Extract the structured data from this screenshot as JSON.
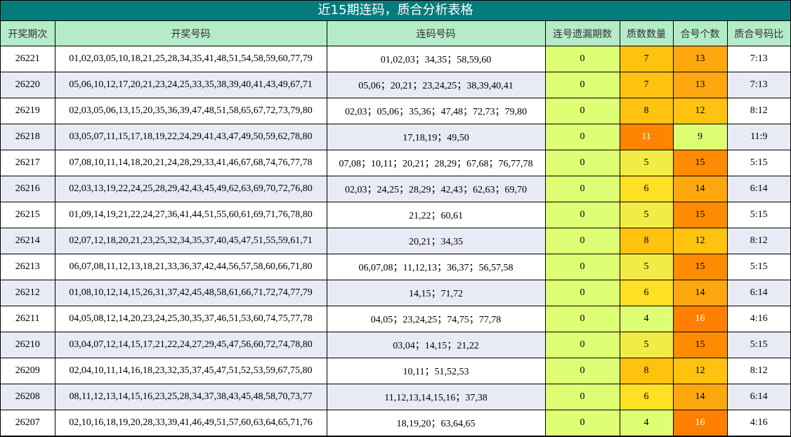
{
  "title": "近15期连码，质合分析表格",
  "headers": [
    "开奖期次",
    "开奖号码",
    "连码号码",
    "连号遗漏期数",
    "质数数量",
    "合号个数",
    "质合号码比"
  ],
  "colors": {
    "title_bg": "#047c7c",
    "header_bg": "#b4ecc9",
    "row_even_bg": "#e8eaf6",
    "miss_bg": "#deff73",
    "level_4": "#deff73",
    "level_5": "#f4ec46",
    "level_6": "#ffe022",
    "level_7": "#ffc30f",
    "level_8": "#ffc30f",
    "level_9": "#deff73",
    "level_11": "#ff8500",
    "level_12": "#ffc30f",
    "level_13": "#ffa70f",
    "level_14": "#ffa70f",
    "level_15": "#ff8c00",
    "level_16": "#ff8000"
  },
  "rows": [
    {
      "issue": "26221",
      "numbers": "01,02,03,05,10,18,21,25,28,34,35,41,48,51,54,58,59,60,77,79",
      "consecutive": "01,02,03；34,35；58,59,60",
      "miss": "0",
      "prime": "7",
      "composite": "13",
      "ratio": "7:13"
    },
    {
      "issue": "26220",
      "numbers": "05,06,10,12,17,20,21,23,24,25,33,35,38,39,40,41,43,49,67,71",
      "consecutive": "05,06；20,21；23,24,25；38,39,40,41",
      "miss": "0",
      "prime": "7",
      "composite": "13",
      "ratio": "7:13"
    },
    {
      "issue": "26219",
      "numbers": "02,03,05,06,13,15,20,35,36,39,47,48,51,58,65,67,72,73,79,80",
      "consecutive": "02,03；05,06；35,36；47,48；72,73；79,80",
      "miss": "0",
      "prime": "8",
      "composite": "12",
      "ratio": "8:12"
    },
    {
      "issue": "26218",
      "numbers": "03,05,07,11,15,17,18,19,22,24,29,41,43,47,49,50,59,62,78,80",
      "consecutive": "17,18,19；49,50",
      "miss": "0",
      "prime": "11",
      "composite": "9",
      "ratio": "11:9"
    },
    {
      "issue": "26217",
      "numbers": "07,08,10,11,14,18,20,21,24,28,29,33,41,46,67,68,74,76,77,78",
      "consecutive": "07,08；10,11；20,21；28,29；67,68；76,77,78",
      "miss": "0",
      "prime": "5",
      "composite": "15",
      "ratio": "5:15"
    },
    {
      "issue": "26216",
      "numbers": "02,03,13,19,22,24,25,28,29,42,43,45,49,62,63,69,70,72,76,80",
      "consecutive": "02,03；24,25；28,29；42,43；62,63；69,70",
      "miss": "0",
      "prime": "6",
      "composite": "14",
      "ratio": "6:14"
    },
    {
      "issue": "26215",
      "numbers": "01,09,14,19,21,22,24,27,36,41,44,51,55,60,61,69,71,76,78,80",
      "consecutive": "21,22；60,61",
      "miss": "0",
      "prime": "5",
      "composite": "15",
      "ratio": "5:15"
    },
    {
      "issue": "26214",
      "numbers": "02,07,12,18,20,21,23,25,32,34,35,37,40,45,47,51,55,59,61,71",
      "consecutive": "20,21；34,35",
      "miss": "0",
      "prime": "8",
      "composite": "12",
      "ratio": "8:12"
    },
    {
      "issue": "26213",
      "numbers": "06,07,08,11,12,13,18,21,33,36,37,42,44,56,57,58,60,66,71,80",
      "consecutive": "06,07,08；11,12,13；36,37；56,57,58",
      "miss": "0",
      "prime": "5",
      "composite": "15",
      "ratio": "5:15"
    },
    {
      "issue": "26212",
      "numbers": "01,08,10,12,14,15,26,31,37,42,45,48,58,61,66,71,72,74,77,79",
      "consecutive": "14,15；71,72",
      "miss": "0",
      "prime": "6",
      "composite": "14",
      "ratio": "6:14"
    },
    {
      "issue": "26211",
      "numbers": "04,05,08,12,14,20,23,24,25,30,35,37,46,51,53,60,74,75,77,78",
      "consecutive": "04,05；23,24,25；74,75；77,78",
      "miss": "0",
      "prime": "4",
      "composite": "16",
      "ratio": "4:16"
    },
    {
      "issue": "26210",
      "numbers": "03,04,07,12,14,15,17,21,22,24,27,29,45,47,56,60,72,74,78,80",
      "consecutive": "03,04；14,15；21,22",
      "miss": "0",
      "prime": "5",
      "composite": "15",
      "ratio": "5:15"
    },
    {
      "issue": "26209",
      "numbers": "02,04,10,11,14,16,18,23,32,35,37,45,47,51,52,53,59,67,75,80",
      "consecutive": "10,11；51,52,53",
      "miss": "0",
      "prime": "8",
      "composite": "12",
      "ratio": "8:12"
    },
    {
      "issue": "26208",
      "numbers": "08,11,12,13,14,15,16,23,25,28,34,37,38,43,45,48,58,70,73,77",
      "consecutive": "11,12,13,14,15,16；37,38",
      "miss": "0",
      "prime": "6",
      "composite": "14",
      "ratio": "6:14"
    },
    {
      "issue": "26207",
      "numbers": "02,10,16,18,19,20,28,33,39,41,46,49,51,57,60,63,64,65,71,76",
      "consecutive": "18,19,20；63,64,65",
      "miss": "0",
      "prime": "4",
      "composite": "16",
      "ratio": "4:16"
    }
  ]
}
